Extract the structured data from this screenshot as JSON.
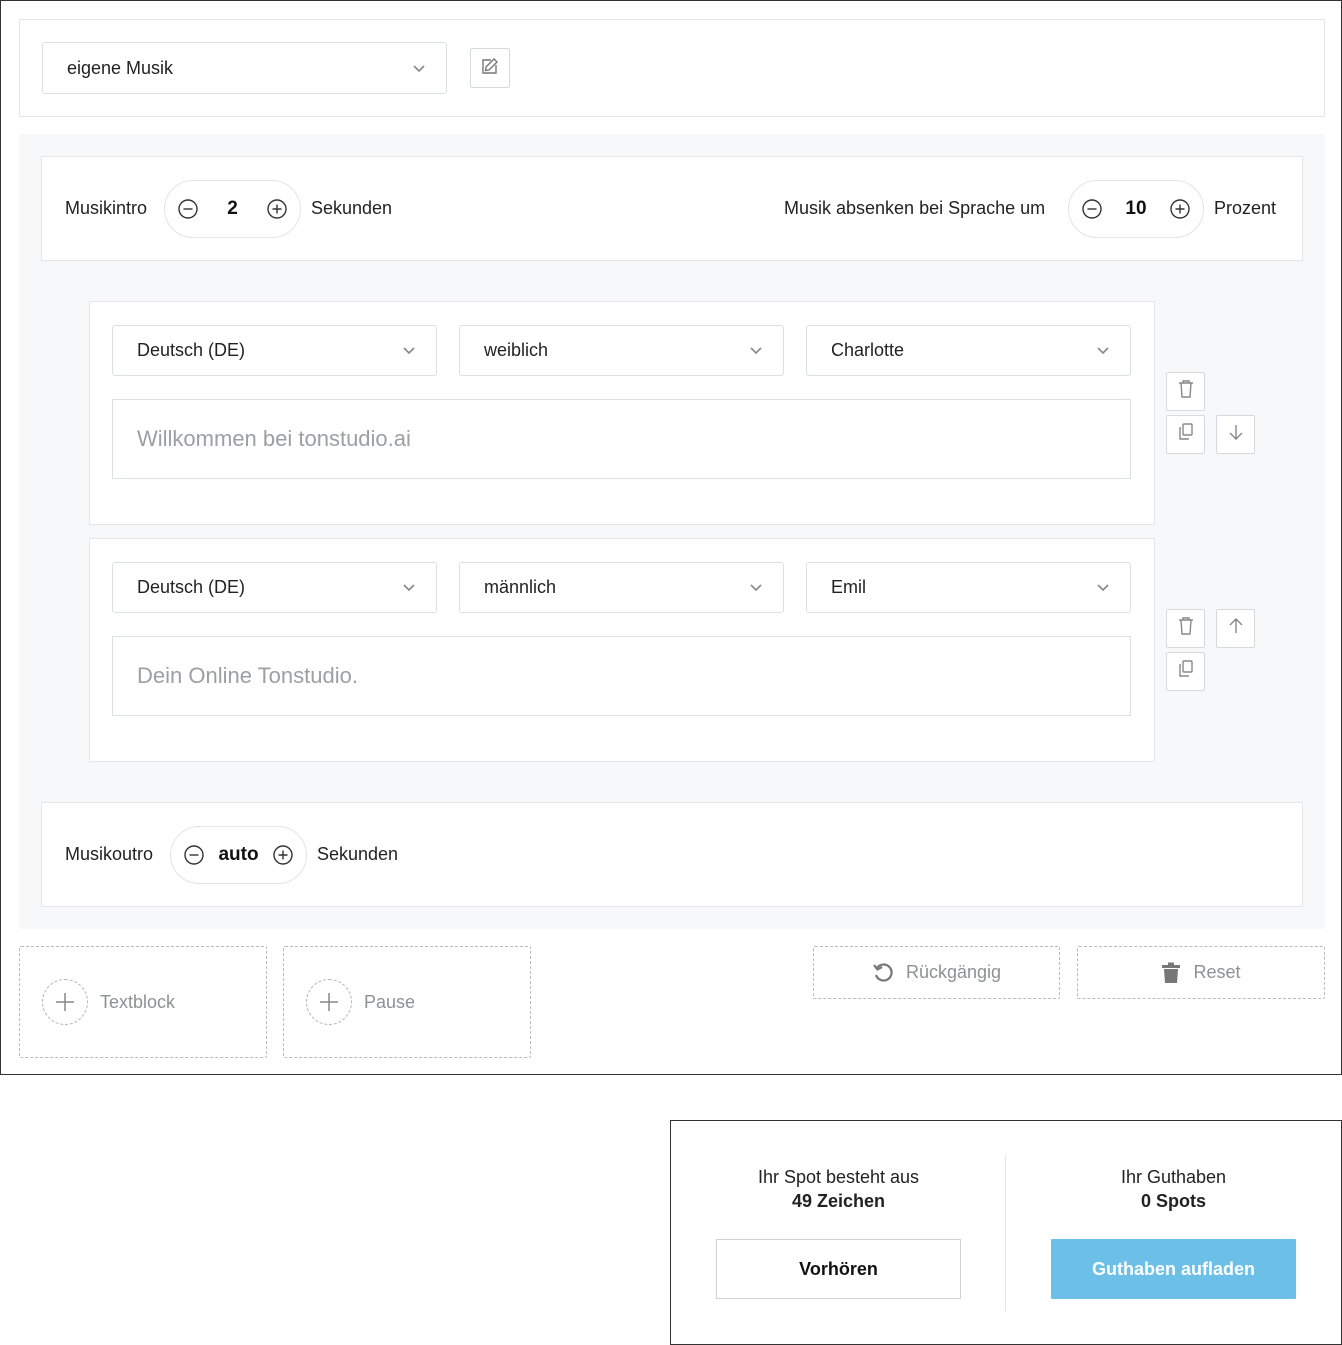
{
  "music": {
    "selected": "eigene Musik",
    "edit_icon": "edit-icon"
  },
  "intro": {
    "label": "Musikintro",
    "value": "2",
    "unit": "Sekunden"
  },
  "ducking": {
    "label": "Musik absenken bei Sprache um",
    "value": "10",
    "unit": "Prozent"
  },
  "blocks": [
    {
      "language": "Deutsch (DE)",
      "gender": "weiblich",
      "voice": "Charlotte",
      "text": "Willkommen bei tonstudio.ai"
    },
    {
      "language": "Deutsch (DE)",
      "gender": "männlich",
      "voice": "Emil",
      "text": "Dein Online Tonstudio."
    }
  ],
  "outro": {
    "label": "Musikoutro",
    "value": "auto",
    "unit": "Sekunden"
  },
  "actions": {
    "add_text": "Textblock",
    "add_pause": "Pause",
    "undo": "Rückgängig",
    "reset": "Reset"
  },
  "summary": {
    "spot_label": "Ihr Spot besteht aus",
    "spot_value": "49 Zeichen",
    "credit_label": "Ihr Guthaben",
    "credit_value": "0 Spots",
    "preview_button": "Vorhören",
    "topup_button": "Guthaben aufladen"
  },
  "colors": {
    "primary": "#6cc0e8",
    "panel_bg": "#f7f8fa",
    "border": "#e4e6ea"
  }
}
